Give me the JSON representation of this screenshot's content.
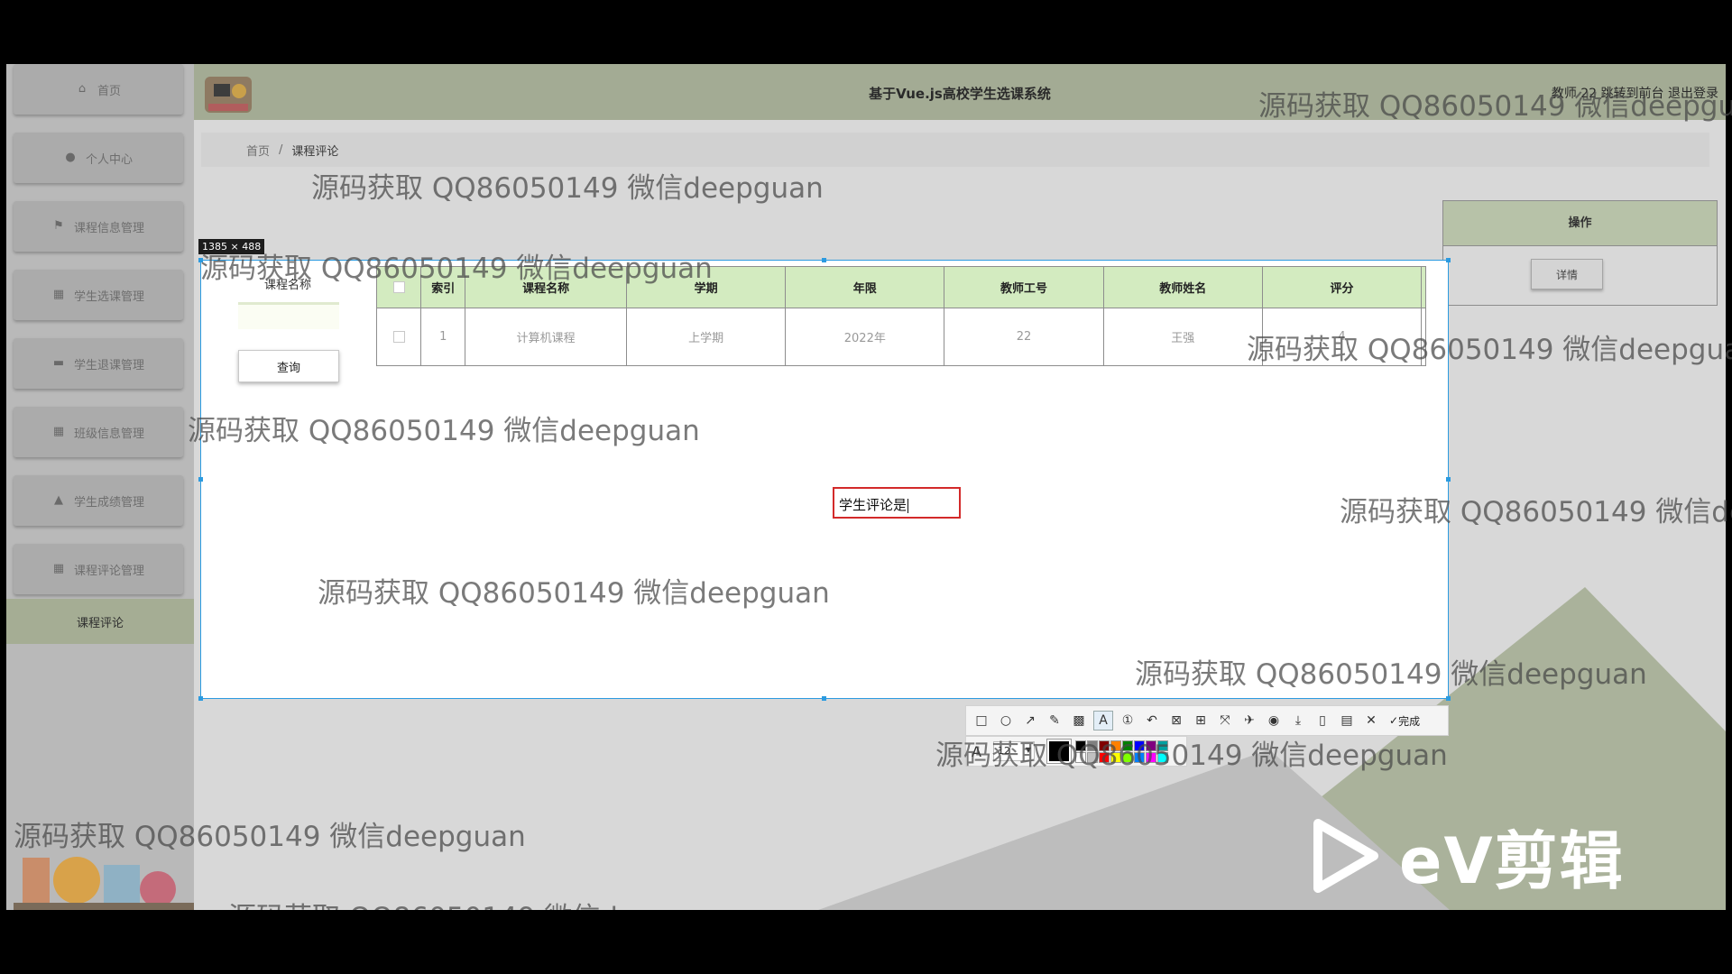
{
  "header": {
    "title": "基于Vue.js高校学生选课系统",
    "user_text": "教师 22 跳转到前台  退出登录"
  },
  "sidebar": {
    "items": [
      {
        "label": "首页",
        "icon": "home-icon",
        "glyph": "⌂"
      },
      {
        "label": "个人中心",
        "icon": "user-icon",
        "glyph": "●"
      },
      {
        "label": "课程信息管理",
        "icon": "flag-icon",
        "glyph": "⚑"
      },
      {
        "label": "学生选课管理",
        "icon": "grid-icon",
        "glyph": "▦"
      },
      {
        "label": "学生退课管理",
        "icon": "ticket-icon",
        "glyph": "▬"
      },
      {
        "label": "班级信息管理",
        "icon": "grid-icon",
        "glyph": "▦"
      },
      {
        "label": "学生成绩管理",
        "icon": "thumb-icon",
        "glyph": "▲"
      },
      {
        "label": "课程评论管理",
        "icon": "grid-icon",
        "glyph": "▦"
      }
    ],
    "sub_item": "课程评论"
  },
  "breadcrumb": {
    "home": "首页",
    "sep": "/",
    "current": "课程评论"
  },
  "capture": {
    "size_label": "1385 × 488"
  },
  "search": {
    "label": "课程名称",
    "button": "查询"
  },
  "table": {
    "columns": [
      "索引",
      "课程名称",
      "学期",
      "年限",
      "教师工号",
      "教师姓名",
      "评分",
      "操作"
    ],
    "rows": [
      {
        "index": "1",
        "course": "计算机课程",
        "term": "上学期",
        "year": "2022年",
        "teacher_id": "22",
        "teacher_name": "王强",
        "score": "4",
        "action": "详情"
      }
    ]
  },
  "text_annotation": {
    "value": "学生评论是"
  },
  "toolbar": {
    "done_label": "完成",
    "font_size": "12",
    "palette": [
      "#000000",
      "#808080",
      "#800000",
      "#ff8000",
      "#008000",
      "#0000ff",
      "#800080",
      "#00a0a0",
      "#ffffff",
      "#c0c0c0",
      "#ff0000",
      "#ffff00",
      "#80ff00",
      "#0080ff",
      "#ff00ff",
      "#00ffff"
    ]
  },
  "watermark": {
    "text": "源码获取 QQ86050149 微信deepguan"
  },
  "ev_logo": {
    "text": "eV剪辑"
  }
}
